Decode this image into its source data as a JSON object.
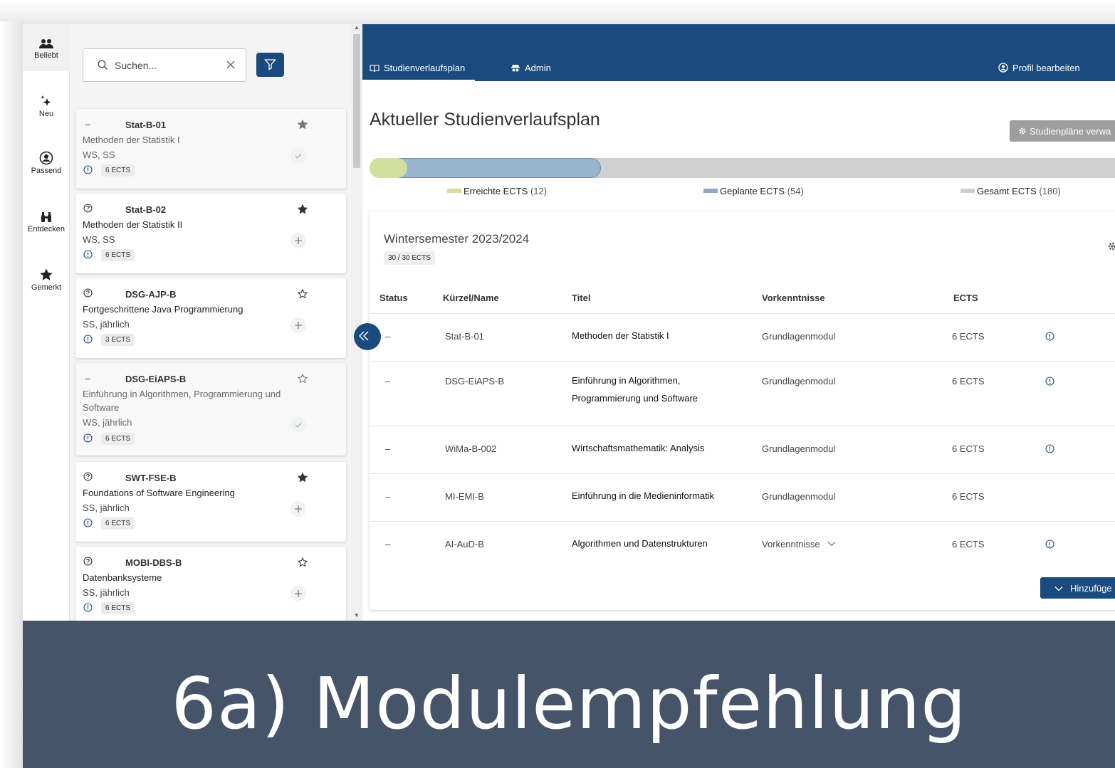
{
  "rail": [
    {
      "label": "Beliebt",
      "icon": "people-icon"
    },
    {
      "label": "Neu",
      "icon": "sparkle-icon"
    },
    {
      "label": "Passend",
      "icon": "user-circle-icon"
    },
    {
      "label": "Entdecken",
      "icon": "binoculars-icon"
    },
    {
      "label": "Gemerkt",
      "icon": "star-icon"
    }
  ],
  "search": {
    "placeholder": "Suchen..."
  },
  "modules": [
    {
      "state": "–",
      "code": "Stat-B-01",
      "name": "Methoden der Statistik I",
      "semester": "WS, SS",
      "ects": "6 ECTS",
      "starred": true,
      "action": "check",
      "dim": true
    },
    {
      "state": "?",
      "code": "Stat-B-02",
      "name": "Methoden der Statistik II",
      "semester": "WS, SS",
      "ects": "6 ECTS",
      "starred": true,
      "action": "plus",
      "dim": false
    },
    {
      "state": "?",
      "code": "DSG-AJP-B",
      "name": "Fortgeschrittene Java Programmierung",
      "semester": "SS, jährlich",
      "ects": "3 ECTS",
      "starred": false,
      "action": "plus",
      "dim": false
    },
    {
      "state": "–",
      "code": "DSG-EiAPS-B",
      "name": "Einführung in Algorithmen, Programmierung und Software",
      "semester": "WS, jährlich",
      "ects": "6 ECTS",
      "starred": false,
      "action": "check",
      "dim": true
    },
    {
      "state": "?",
      "code": "SWT-FSE-B",
      "name": "Foundations of Software Engineering",
      "semester": "SS, jährlich",
      "ects": "6 ECTS",
      "starred": true,
      "action": "plus",
      "dim": false
    },
    {
      "state": "?",
      "code": "MOBI-DBS-B",
      "name": "Datenbanksysteme",
      "semester": "SS, jährlich",
      "ects": "6 ECTS",
      "starred": false,
      "action": "plus",
      "dim": false
    }
  ],
  "nav": {
    "tab1": "Studienverlaufsplan",
    "tab2": "Admin",
    "profile": "Profil bearbeiten"
  },
  "page": {
    "title": "Aktueller Studienverlaufsplan",
    "manage_button": "Studienpläne verwa"
  },
  "progress": {
    "reached": 12,
    "planned": 54,
    "total": 180,
    "legend_reached": "Erreichte ECTS",
    "legend_reached_val": "(12)",
    "legend_planned": "Geplante ECTS",
    "legend_planned_val": "(54)",
    "legend_total": "Gesamt ECTS",
    "legend_total_val": "(180)",
    "color_reached": "#d3df9e",
    "color_planned": "#9ab6cf",
    "color_total": "#cfcfcf"
  },
  "semester": {
    "title": "Wintersemester 2023/2024",
    "badge": "30 / 30 ECTS",
    "headers": {
      "status": "Status",
      "code": "Kürzel/Name",
      "title": "Titel",
      "prereq": "Vorkenntnisse",
      "ects": "ECTS"
    },
    "rows": [
      {
        "status": "–",
        "code": "Stat-B-01",
        "title": "Methoden der Statistik I",
        "prereq": "Grundlagenmodul",
        "ects": "6 ECTS",
        "info": true
      },
      {
        "status": "–",
        "code": "DSG-EiAPS-B",
        "title": "Einführung in Algorithmen, Programmierung und Software",
        "prereq": "Grundlagenmodul",
        "ects": "6 ECTS",
        "info": true
      },
      {
        "status": "–",
        "code": "WiMa-B-002",
        "title": "Wirtschaftsmathematik: Analysis",
        "prereq": "Grundlagenmodul",
        "ects": "6 ECTS",
        "info": true
      },
      {
        "status": "–",
        "code": "MI-EMI-B",
        "title": "Einführung in die Medieninformatik",
        "prereq": "Grundlagenmodul",
        "ects": "6 ECTS",
        "info": false
      },
      {
        "status": "–",
        "code": "AI-AuD-B",
        "title": "Algorithmen und Datenstrukturen",
        "prereq": "Vorkenntnisse",
        "ects": "6 ECTS",
        "info": true
      }
    ],
    "add_button": "Hinzufüge"
  },
  "banner": {
    "text": "6a) Modulempfehlung"
  },
  "colors": {
    "primary": "#1b4b7e",
    "banner": "#46546a"
  }
}
